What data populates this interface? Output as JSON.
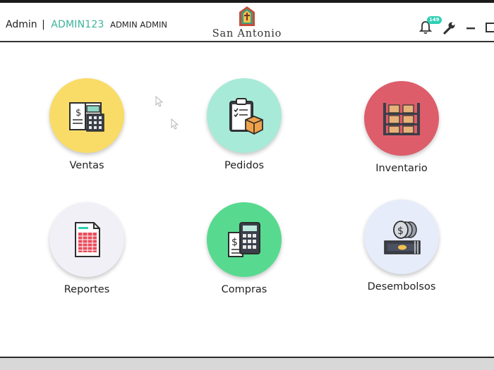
{
  "header": {
    "role": "Admin",
    "separator": "|",
    "user_id": "ADMIN123",
    "full_name": "ADMIN ADMIN",
    "brand": "San Antonio",
    "notification_count": "149",
    "icons": [
      "bell-icon",
      "wrench-icon",
      "minimize-icon",
      "maximize-icon"
    ]
  },
  "tiles": [
    {
      "label": "Ventas",
      "color": "#f9dc67",
      "icon": "cash-register-icon"
    },
    {
      "label": "Pedidos",
      "color": "#a8ead8",
      "icon": "clipboard-box-icon"
    },
    {
      "label": "Inventario",
      "color": "#de5d6b",
      "icon": "warehouse-shelf-icon"
    },
    {
      "label": "Reportes",
      "color": "#f1f0f7",
      "icon": "report-sheet-icon"
    },
    {
      "label": "Compras",
      "color": "#57da8f",
      "icon": "calculator-receipt-icon"
    },
    {
      "label": "Desembolsos",
      "color": "#e7ecfa",
      "icon": "coins-cash-icon"
    }
  ],
  "colors": {
    "accent": "#3bb39a",
    "badge": "#2ecfb2"
  }
}
